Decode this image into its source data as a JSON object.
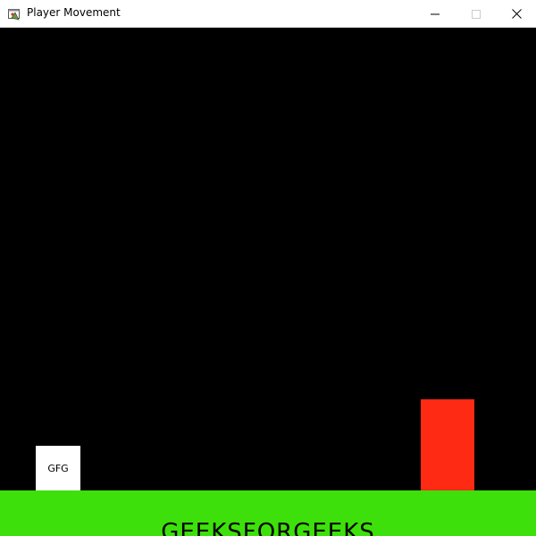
{
  "window": {
    "title": "Player Movement",
    "icon": "pygame-app-icon",
    "controls": {
      "minimize_icon": "minimize-icon",
      "maximize_icon": "maximize-icon",
      "close_icon": "close-icon"
    }
  },
  "game": {
    "background_color": "#000000",
    "player": {
      "label": "GFG",
      "color": "#ffffff"
    },
    "obstacle": {
      "color": "#ff2a14"
    },
    "ground": {
      "color": "#3ee00c",
      "text": "GEEKSFORGEEKS"
    }
  }
}
